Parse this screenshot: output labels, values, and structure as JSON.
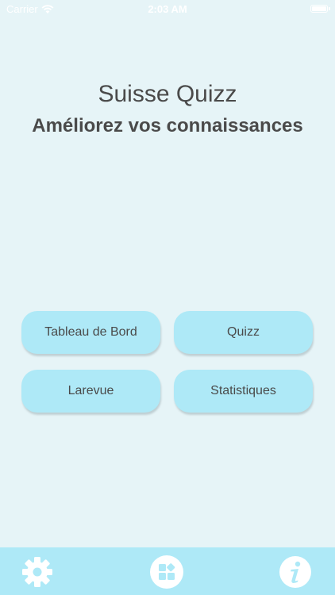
{
  "status_bar": {
    "carrier": "Carrier",
    "time": "2:03 AM"
  },
  "header": {
    "title": "Suisse Quizz",
    "subtitle": "Améliorez vos connaissances"
  },
  "menu": {
    "dashboard_label": "Tableau de Bord",
    "quiz_label": "Quizz",
    "review_label": "Larevue",
    "stats_label": "Statistiques"
  },
  "tab_bar": {
    "icons": [
      "gear-icon",
      "grid-icon",
      "info-icon"
    ]
  },
  "colors": {
    "background": "#e6f4f7",
    "button": "#aee9f7",
    "text": "#4a4a4a",
    "icon": "#ffffff"
  }
}
